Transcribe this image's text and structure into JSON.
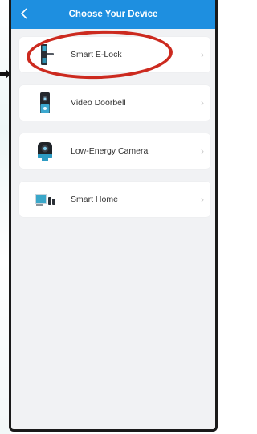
{
  "header": {
    "title": "Choose Your Device",
    "back_icon": "chevron-left-icon"
  },
  "devices": [
    {
      "label": "Smart E-Lock",
      "icon": "smart-lock-icon",
      "chevron": "›"
    },
    {
      "label": "Video Doorbell",
      "icon": "doorbell-icon",
      "chevron": "›"
    },
    {
      "label": "Low-Energy Camera",
      "icon": "camera-icon",
      "chevron": "›"
    },
    {
      "label": "Smart Home",
      "icon": "smart-home-icon",
      "chevron": "›"
    }
  ],
  "colors": {
    "header": "#1e8fe0",
    "background": "#f1f2f4",
    "annotation": "#cc2a1f"
  }
}
